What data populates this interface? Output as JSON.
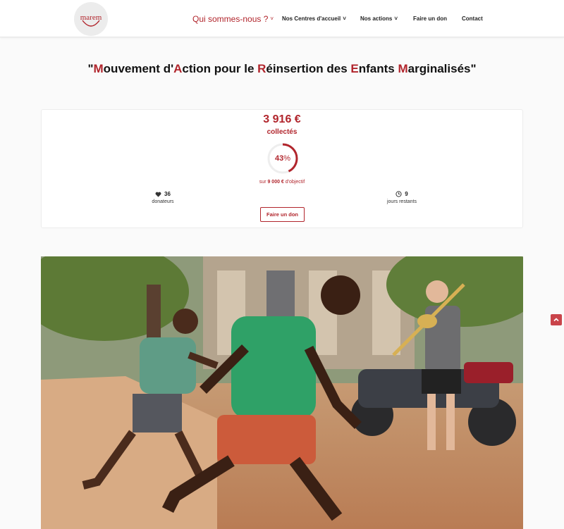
{
  "brand": {
    "logo_text": "marem",
    "accent_color": "#b1252c"
  },
  "nav": {
    "items": [
      {
        "label": "Qui sommes-nous ?",
        "has_dropdown": true,
        "active": true
      },
      {
        "label": "Nos Centres d'accueil",
        "has_dropdown": true
      },
      {
        "label": "Nos actions",
        "has_dropdown": true
      },
      {
        "label": "Faire un don",
        "has_dropdown": false
      },
      {
        "label": "Contact",
        "has_dropdown": false
      }
    ]
  },
  "title": {
    "open_quote": "\"",
    "parts": [
      {
        "initial": "M",
        "rest": "ouvement d'"
      },
      {
        "initial": "A",
        "rest": "ction pour le "
      },
      {
        "initial": "R",
        "rest": "éinsertion des "
      },
      {
        "initial": "E",
        "rest": "nfants "
      },
      {
        "initial": "M",
        "rest": "arginalisés"
      }
    ],
    "close_quote": "\""
  },
  "donation": {
    "amount": "3 916 €",
    "amount_label": "collectés",
    "progress_percent": 43,
    "progress_number": "43",
    "progress_unit": "%",
    "goal_prefix": "sur ",
    "goal_amount": "9 000 €",
    "goal_suffix": " d'objectif",
    "donors_count": "36",
    "donors_label": "donateurs",
    "days_count": "9",
    "days_label": "jours restants",
    "button_label": "Faire un don",
    "icons": {
      "donors": "heart-icon",
      "days": "clock-icon"
    }
  },
  "photo": {
    "icon": "photo-children-playing"
  },
  "scroll_top": {
    "icon": "chevron-up-icon"
  }
}
